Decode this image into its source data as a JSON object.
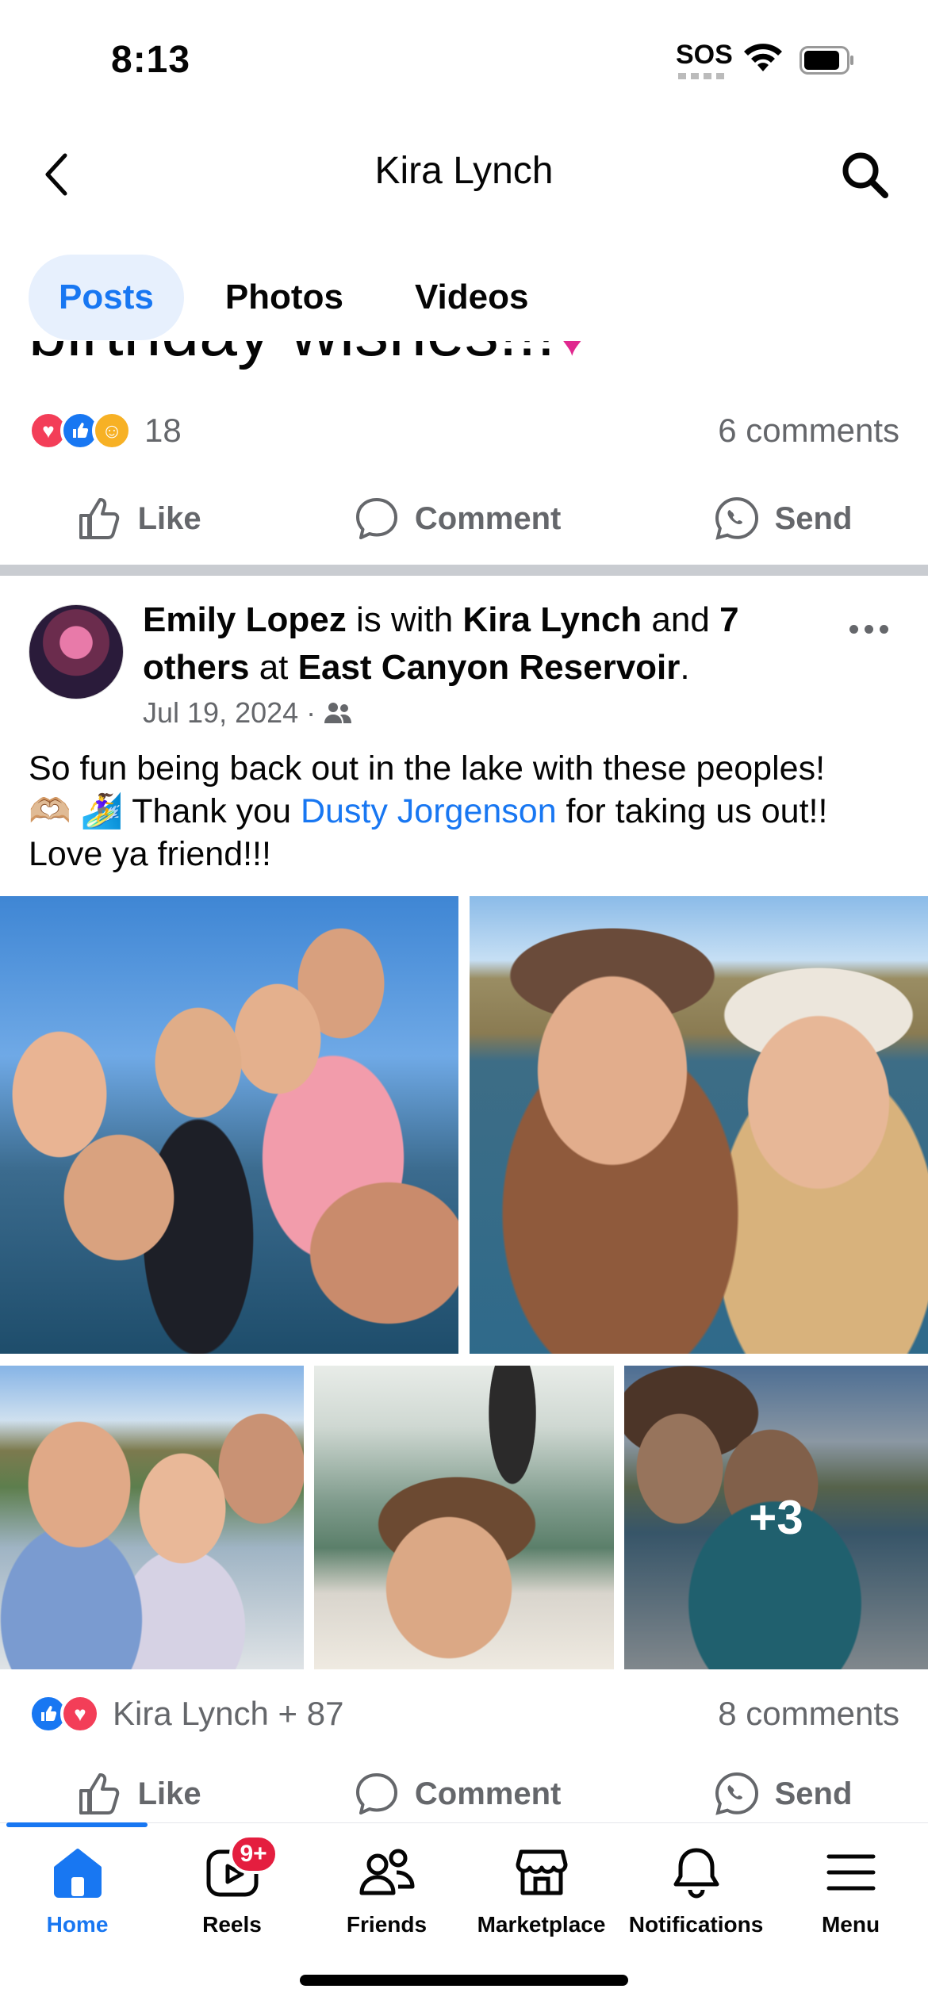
{
  "status": {
    "time": "8:13",
    "sos": "SOS"
  },
  "header": {
    "title": "Kira Lynch"
  },
  "tabs": [
    {
      "label": "Posts"
    },
    {
      "label": "Photos"
    },
    {
      "label": "Videos"
    }
  ],
  "prev_post": {
    "caption": "birthday wishes!!!",
    "reaction_count": "18",
    "comments": "6 comments"
  },
  "actions": {
    "like": "Like",
    "comment": "Comment",
    "send": "Send"
  },
  "post": {
    "author": "Emily Lopez",
    "with_text": " is with ",
    "tagged": "Kira Lynch",
    "and_text": " and ",
    "others": "7 others",
    "at_text": " at ",
    "place": "East Canyon Reservoir",
    "period": ".",
    "date": "Jul 19, 2024",
    "sep": "·",
    "text_1": "So fun being back out in the lake with these peoples!",
    "text_emoji": "🫶🏼 🏄‍♀️",
    "text_2": " Thank you ",
    "mention": "Dusty Jorgenson",
    "text_3": " for taking us out!!",
    "text_4": "Love ya friend!!!",
    "more_photos": "+3",
    "reactions_label": "Kira Lynch + 87",
    "comments": "8 comments"
  },
  "nav": {
    "home": "Home",
    "reels": "Reels",
    "reels_badge": "9+",
    "friends": "Friends",
    "marketplace": "Marketplace",
    "notifications": "Notifications",
    "menu": "Menu"
  },
  "colors": {
    "accent": "#1877f2",
    "badge": "#e41e3f",
    "secondary_text": "#65676b"
  }
}
